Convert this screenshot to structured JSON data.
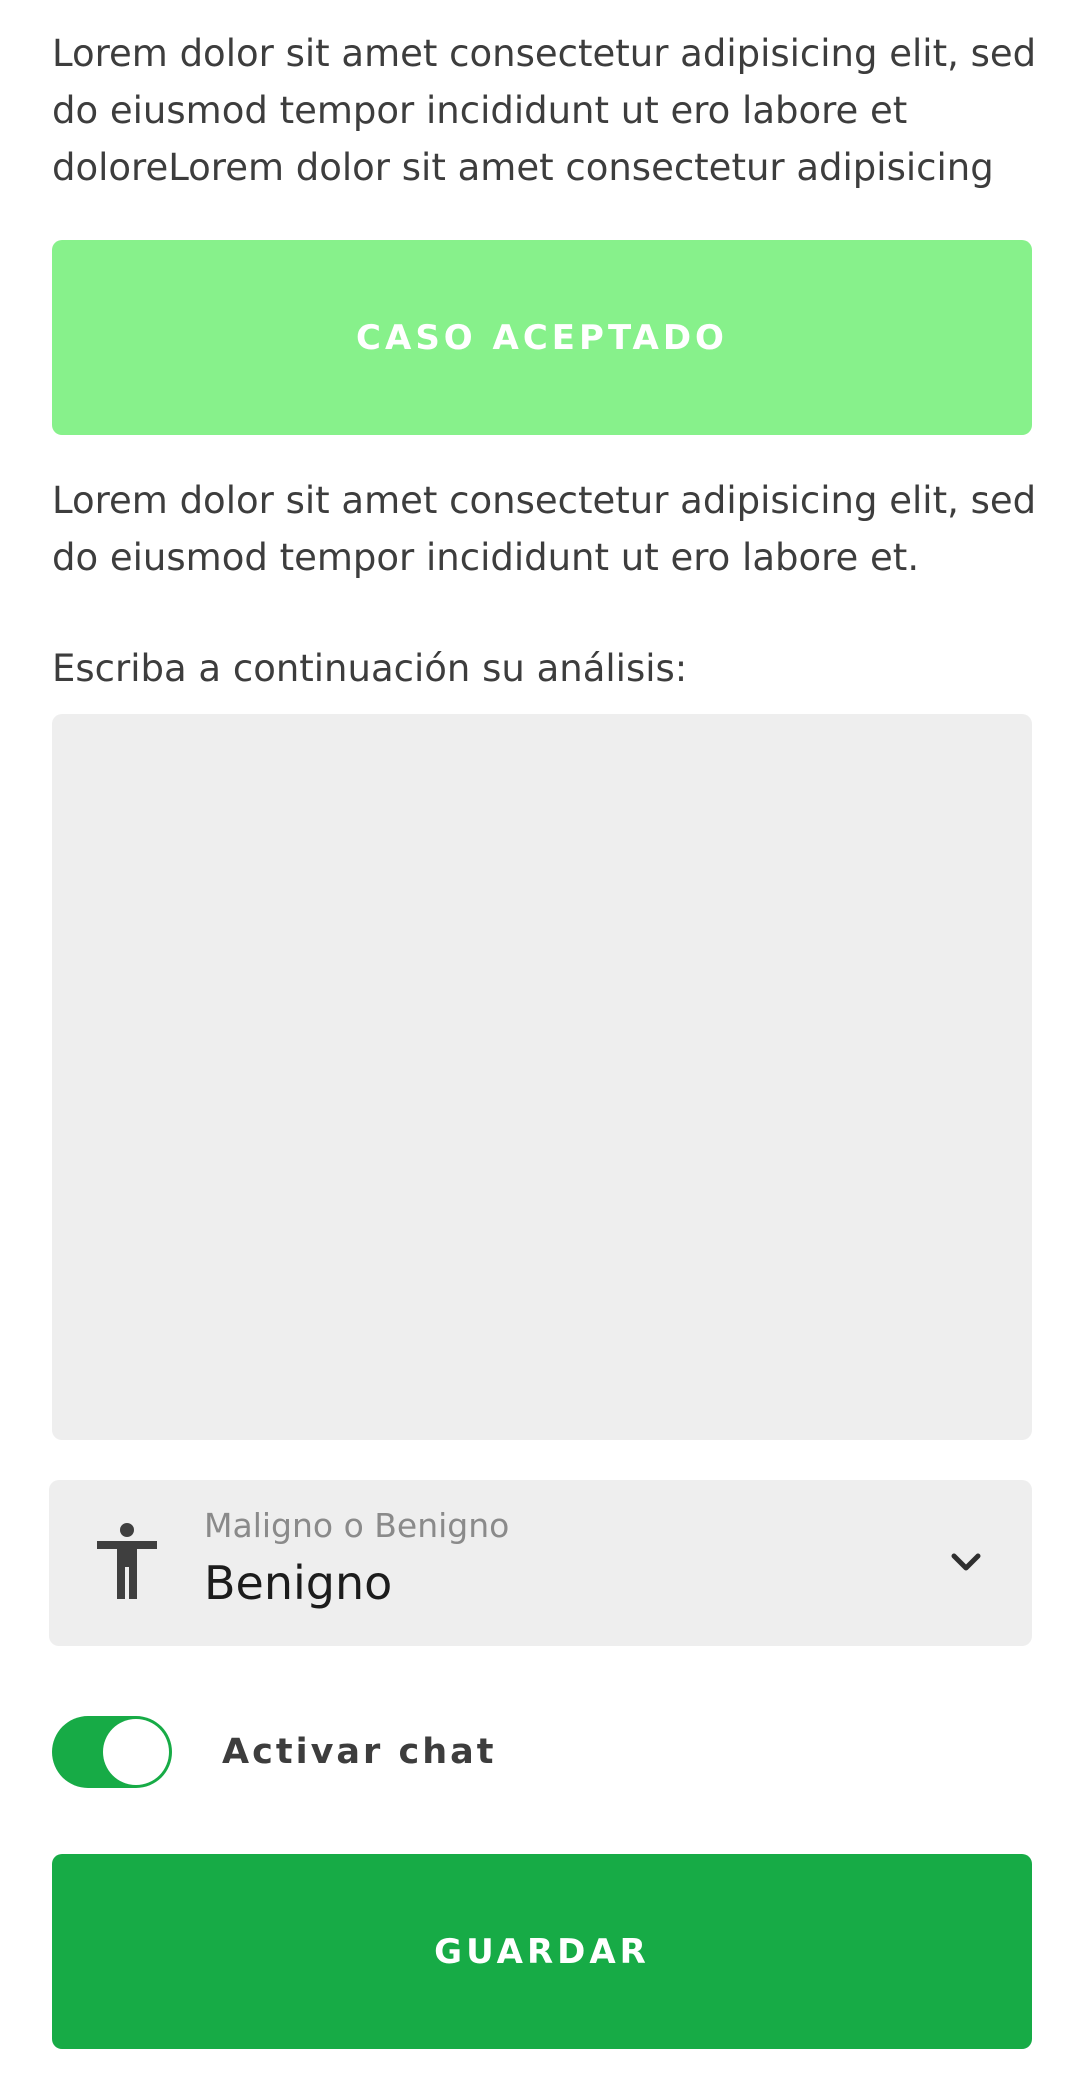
{
  "intro_text": "Lorem dolor sit amet consectetur adipisicing elit, sed do eiusmod tempor incididunt ut ero labore et doloreLorem dolor sit amet consectetur adipisicing",
  "status_button": {
    "label": "CASO ACEPTADO",
    "color": "#87f18b"
  },
  "secondary_text": "Lorem dolor sit amet consectetur adipisicing elit, sed do eiusmod tempor incididunt ut ero labore et.",
  "analysis": {
    "label": "Escriba a continuación su análisis:",
    "value": ""
  },
  "diagnosis_select": {
    "icon": "accessibility-icon",
    "floating_label": "Maligno o Benigno",
    "value": "Benigno",
    "chevron_icon": "chevron-down-icon"
  },
  "chat_toggle": {
    "label": "Activar chat",
    "on": true,
    "color": "#17ab46"
  },
  "save_button": {
    "label": "GUARDAR",
    "color": "#17ab46"
  }
}
